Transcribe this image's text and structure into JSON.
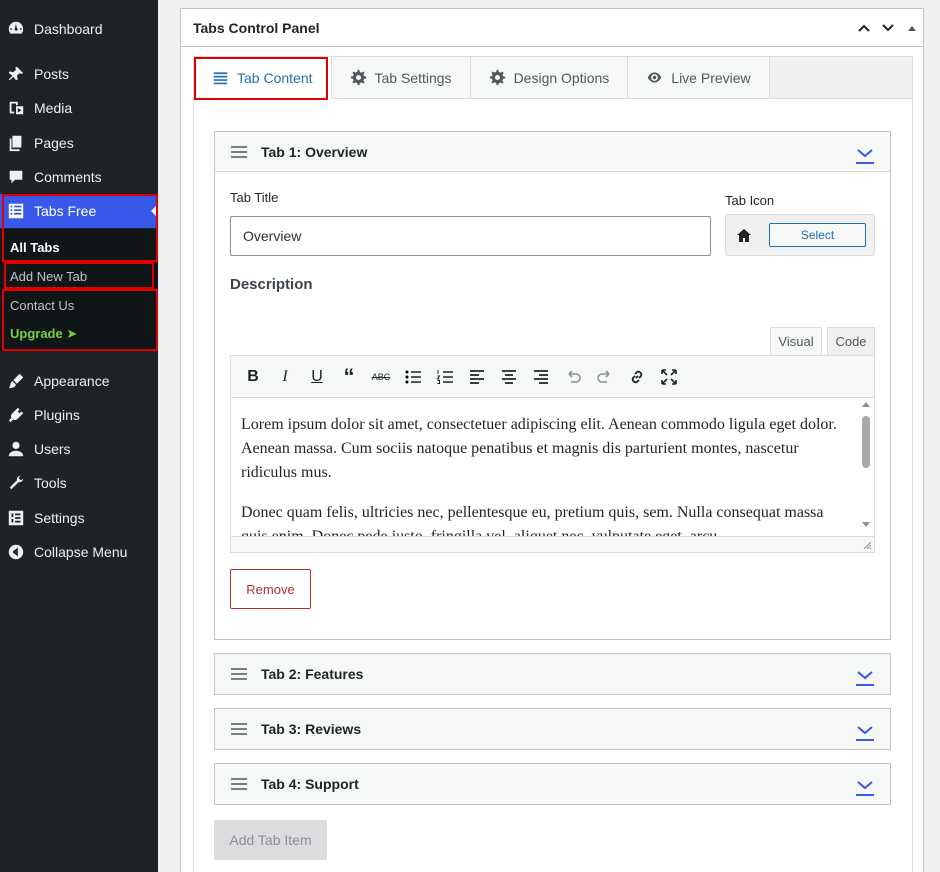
{
  "sidebar": {
    "items": [
      {
        "label": "Dashboard",
        "icon": "dashboard-icon"
      },
      {
        "label": "Posts",
        "icon": "pin-icon"
      },
      {
        "label": "Media",
        "icon": "media-icon"
      },
      {
        "label": "Pages",
        "icon": "pages-icon"
      },
      {
        "label": "Comments",
        "icon": "comment-icon"
      },
      {
        "label": "Tabs Free",
        "icon": "list-icon"
      },
      {
        "label": "Appearance",
        "icon": "brush-icon"
      },
      {
        "label": "Plugins",
        "icon": "plugin-icon"
      },
      {
        "label": "Users",
        "icon": "user-icon"
      },
      {
        "label": "Tools",
        "icon": "wrench-icon"
      },
      {
        "label": "Settings",
        "icon": "settings-icon"
      },
      {
        "label": "Collapse Menu",
        "icon": "collapse-icon"
      }
    ],
    "submenu": {
      "all_tabs": "All Tabs",
      "add_new": "Add New Tab",
      "contact": "Contact Us",
      "upgrade": "Upgrade ➤"
    }
  },
  "panel": {
    "title": "Tabs Control Panel",
    "tabs": [
      {
        "label": "Tab Content"
      },
      {
        "label": "Tab Settings"
      },
      {
        "label": "Design Options"
      },
      {
        "label": "Live Preview"
      }
    ]
  },
  "tab1": {
    "heading": "Tab 1: Overview",
    "title_label": "Tab Title",
    "title_value": "Overview",
    "icon_label": "Tab Icon",
    "select_label": "Select",
    "description_label": "Description",
    "mode_visual": "Visual",
    "mode_code": "Code",
    "paragraph1": "Lorem ipsum dolor sit amet, consectetuer adipiscing elit. Aenean commodo ligula eget dolor. Aenean massa. Cum sociis natoque penatibus et magnis dis parturient montes, nascetur ridiculus mus.",
    "paragraph2": "Donec quam felis, ultricies nec, pellentesque eu, pretium quis, sem. Nulla consequat massa quis enim. Donec pede justo, fringilla vel, aliquet nec, vulputate eget, arcu.",
    "remove_label": "Remove"
  },
  "collapsed_tabs": [
    {
      "heading": "Tab 2: Features"
    },
    {
      "heading": "Tab 3: Reviews"
    },
    {
      "heading": "Tab 4: Support"
    }
  ],
  "add_label": "Add Tab Item",
  "colors": {
    "accent": "#3858e9",
    "link": "#2271b1",
    "highlight_box": "#e00000",
    "danger": "#b32d2e",
    "upgrade": "#7ad03a"
  }
}
